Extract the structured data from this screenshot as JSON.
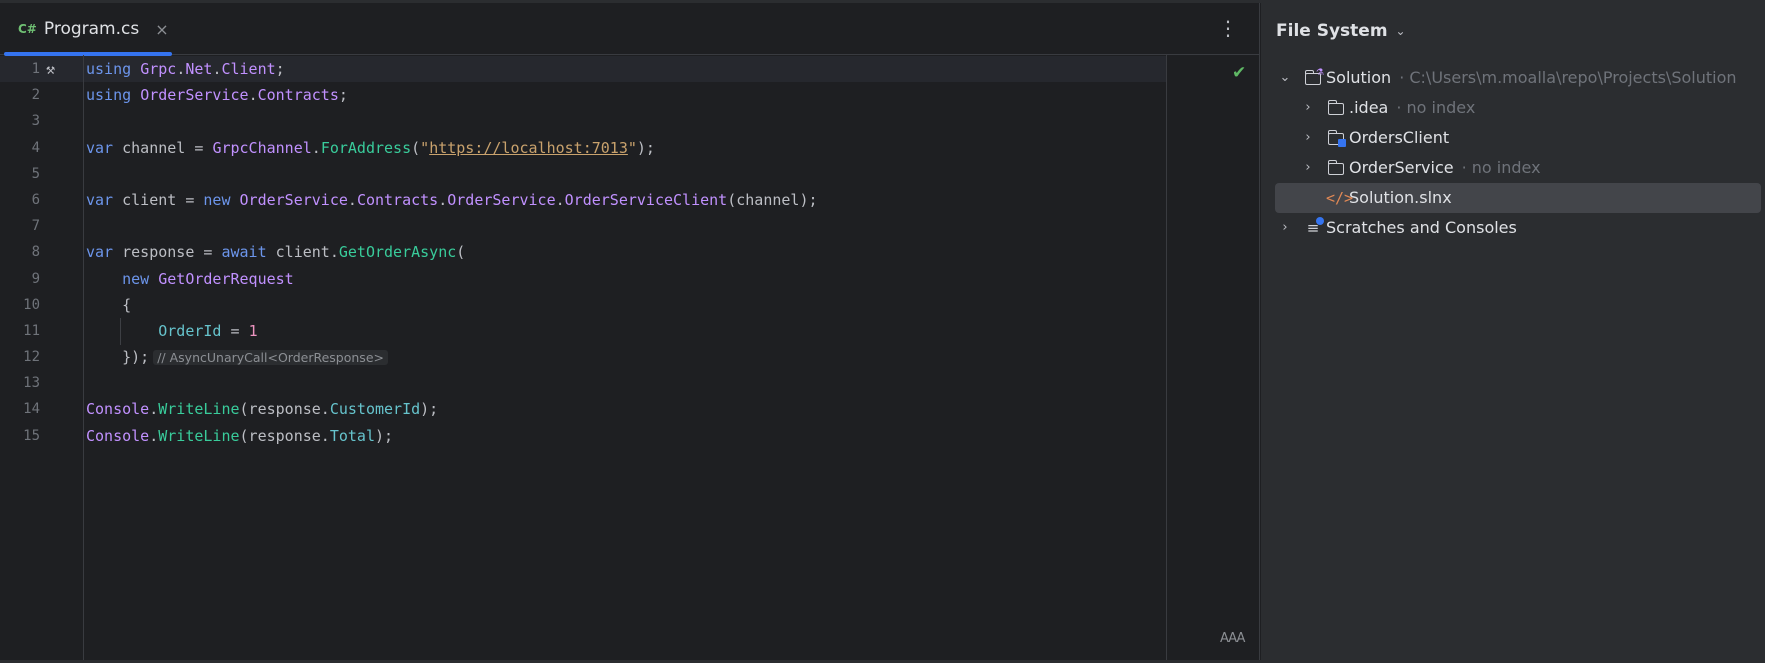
{
  "tab": {
    "lang_badge": "C#",
    "file_name": "Program.cs",
    "close_glyph": "×"
  },
  "editor": {
    "more_icon": "more-vertical-icon",
    "inspection_icon": "check-icon",
    "gutter_icon": "hammer-icon",
    "reader_mode_label": "AAA",
    "line_numbers": [
      "1",
      "2",
      "3",
      "4",
      "5",
      "6",
      "7",
      "8",
      "9",
      "10",
      "11",
      "12",
      "13",
      "14",
      "15"
    ],
    "lines": [
      [
        [
          "kw",
          "using"
        ],
        [
          "",
          " "
        ],
        [
          "ns",
          "Grpc"
        ],
        [
          "",
          "."
        ],
        [
          "ns",
          "Net"
        ],
        [
          "",
          "."
        ],
        [
          "ns",
          "Client"
        ],
        [
          "",
          ";"
        ]
      ],
      [
        [
          "kw",
          "using"
        ],
        [
          "",
          " "
        ],
        [
          "ns",
          "OrderService"
        ],
        [
          "",
          "."
        ],
        [
          "ns",
          "Contracts"
        ],
        [
          "",
          ";"
        ]
      ],
      [],
      [
        [
          "kw",
          "var"
        ],
        [
          "",
          " channel = "
        ],
        [
          "cls",
          "GrpcChannel"
        ],
        [
          "",
          "."
        ],
        [
          "mth",
          "ForAddress"
        ],
        [
          "",
          "("
        ],
        [
          "str",
          "\""
        ],
        [
          "url",
          "https://localhost:7013"
        ],
        [
          "str",
          "\""
        ],
        [
          "",
          ");"
        ]
      ],
      [],
      [
        [
          "kw",
          "var"
        ],
        [
          "",
          " client = "
        ],
        [
          "kw",
          "new"
        ],
        [
          "",
          " "
        ],
        [
          "ns",
          "OrderService"
        ],
        [
          "",
          "."
        ],
        [
          "ns",
          "Contracts"
        ],
        [
          "",
          "."
        ],
        [
          "cls",
          "OrderService"
        ],
        [
          "",
          "."
        ],
        [
          "cls",
          "OrderServiceClient"
        ],
        [
          "",
          "(channel);"
        ]
      ],
      [],
      [
        [
          "kw",
          "var"
        ],
        [
          "",
          " response = "
        ],
        [
          "kw",
          "await"
        ],
        [
          "",
          " client."
        ],
        [
          "mth",
          "GetOrderAsync"
        ],
        [
          "",
          "("
        ]
      ],
      [
        [
          "",
          "    "
        ],
        [
          "kw",
          "new"
        ],
        [
          "",
          " "
        ],
        [
          "cls",
          "GetOrderRequest"
        ]
      ],
      [
        [
          "",
          "    {"
        ]
      ],
      [
        [
          "",
          "        "
        ],
        [
          "prop",
          "OrderId"
        ],
        [
          "",
          " = "
        ],
        [
          "num",
          "1"
        ]
      ],
      [
        [
          "",
          "    });"
        ],
        [
          "hint",
          "// AsyncUnaryCall<OrderResponse>"
        ]
      ],
      [],
      [
        [
          "cls",
          "Console"
        ],
        [
          "",
          "."
        ],
        [
          "mth",
          "WriteLine"
        ],
        [
          "",
          "(response."
        ],
        [
          "prop",
          "CustomerId"
        ],
        [
          "",
          ");"
        ]
      ],
      [
        [
          "cls",
          "Console"
        ],
        [
          "",
          "."
        ],
        [
          "mth",
          "WriteLine"
        ],
        [
          "",
          "(response."
        ],
        [
          "prop",
          "Total"
        ],
        [
          "",
          ");"
        ]
      ]
    ]
  },
  "panel": {
    "title": "File System",
    "items": [
      {
        "label": "Solution",
        "hint": "· C:\\Users\\m.moalla\\repo\\Projects\\Solution"
      },
      {
        "label": ".idea",
        "hint": "· no index"
      },
      {
        "label": "OrdersClient",
        "hint": ""
      },
      {
        "label": "OrderService",
        "hint": "· no index"
      },
      {
        "label": "Solution.slnx",
        "hint": ""
      },
      {
        "label": "Scratches and Consoles",
        "hint": ""
      }
    ]
  },
  "colors": {
    "accent": "#3574f0",
    "keyword": "#6c95eb",
    "type": "#c191ff",
    "method": "#39cc9b",
    "property": "#66c3cc",
    "string": "#c9a26d",
    "number": "#ed94c0",
    "ok": "#5fb865"
  }
}
